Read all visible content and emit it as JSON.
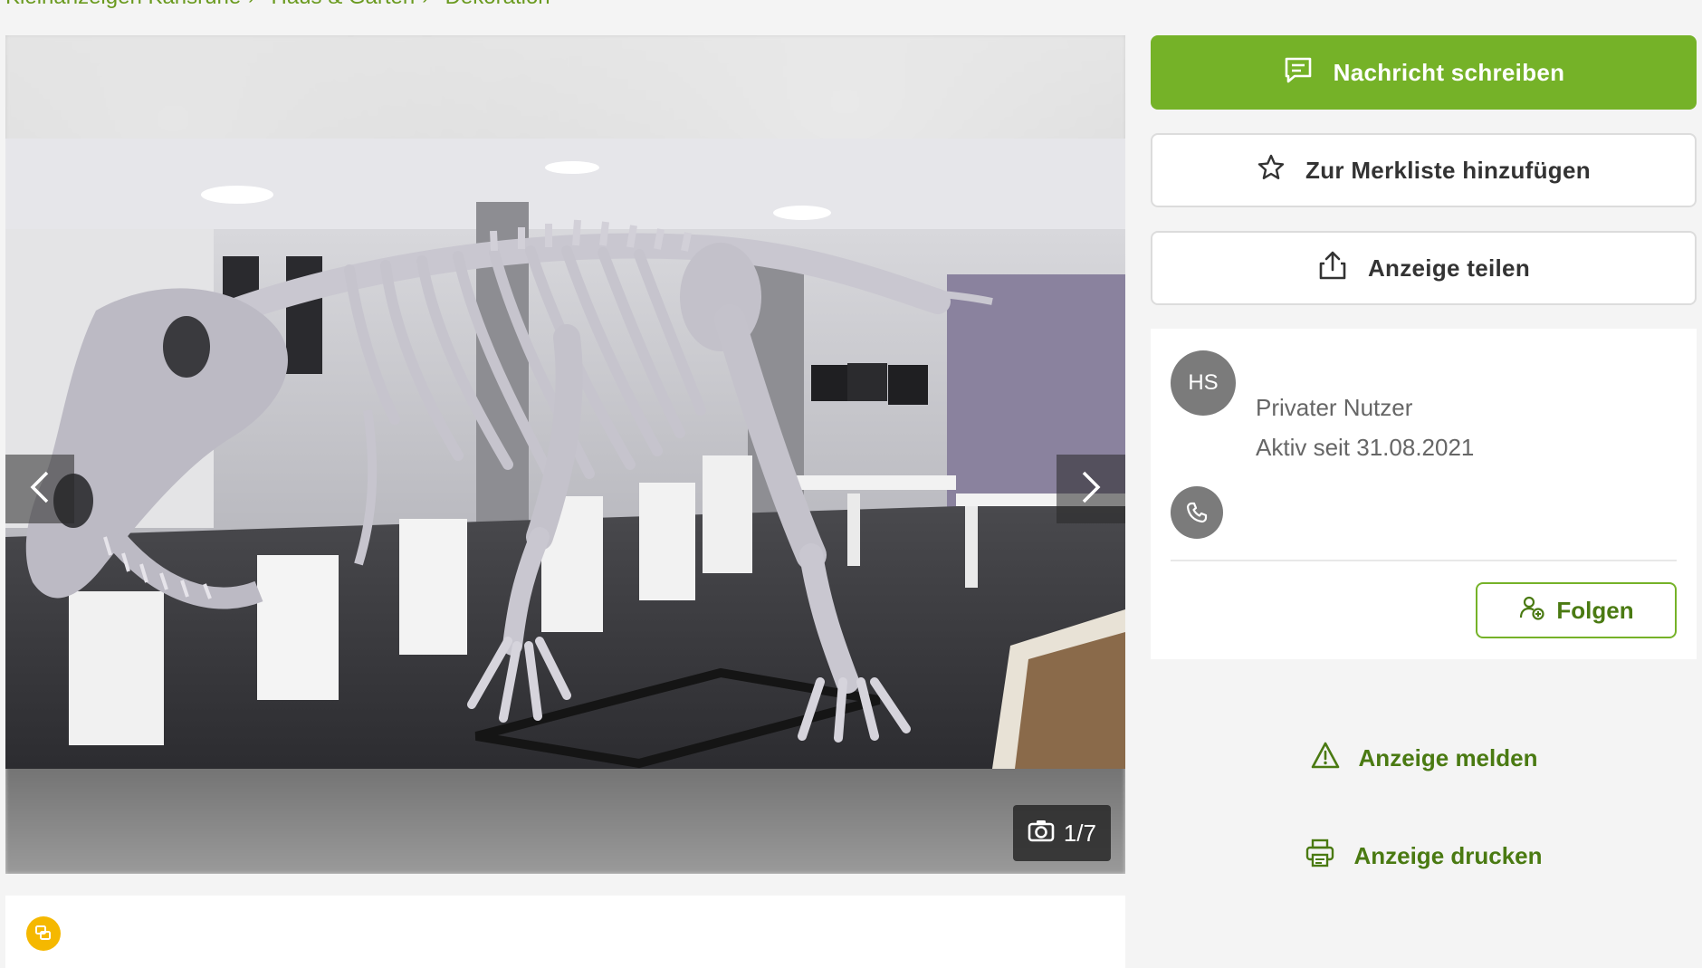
{
  "breadcrumb": [
    {
      "label": "Kleinanzeigen Karlsruhe"
    },
    {
      "label": "Haus & Garten"
    },
    {
      "label": "Dekoration"
    }
  ],
  "gallery": {
    "counter": "1/7",
    "icons": {
      "prev": "chevron-left-icon",
      "next": "chevron-right-icon",
      "counter": "camera-icon"
    }
  },
  "actions": {
    "message_label": "Nachricht schreiben",
    "watchlist_label": "Zur Merkliste hinzufügen",
    "share_label": "Anzeige teilen",
    "report_label": "Anzeige melden",
    "print_label": "Anzeige drucken"
  },
  "seller": {
    "initials": "HS",
    "type": "Privater Nutzer",
    "active_since": "Aktiv seit 31.08.2021",
    "follow_label": "Folgen"
  },
  "colors": {
    "accent": "#75b228",
    "link": "#4a7a12",
    "badge": "#f5b800",
    "avatar": "#7b7b7b"
  }
}
